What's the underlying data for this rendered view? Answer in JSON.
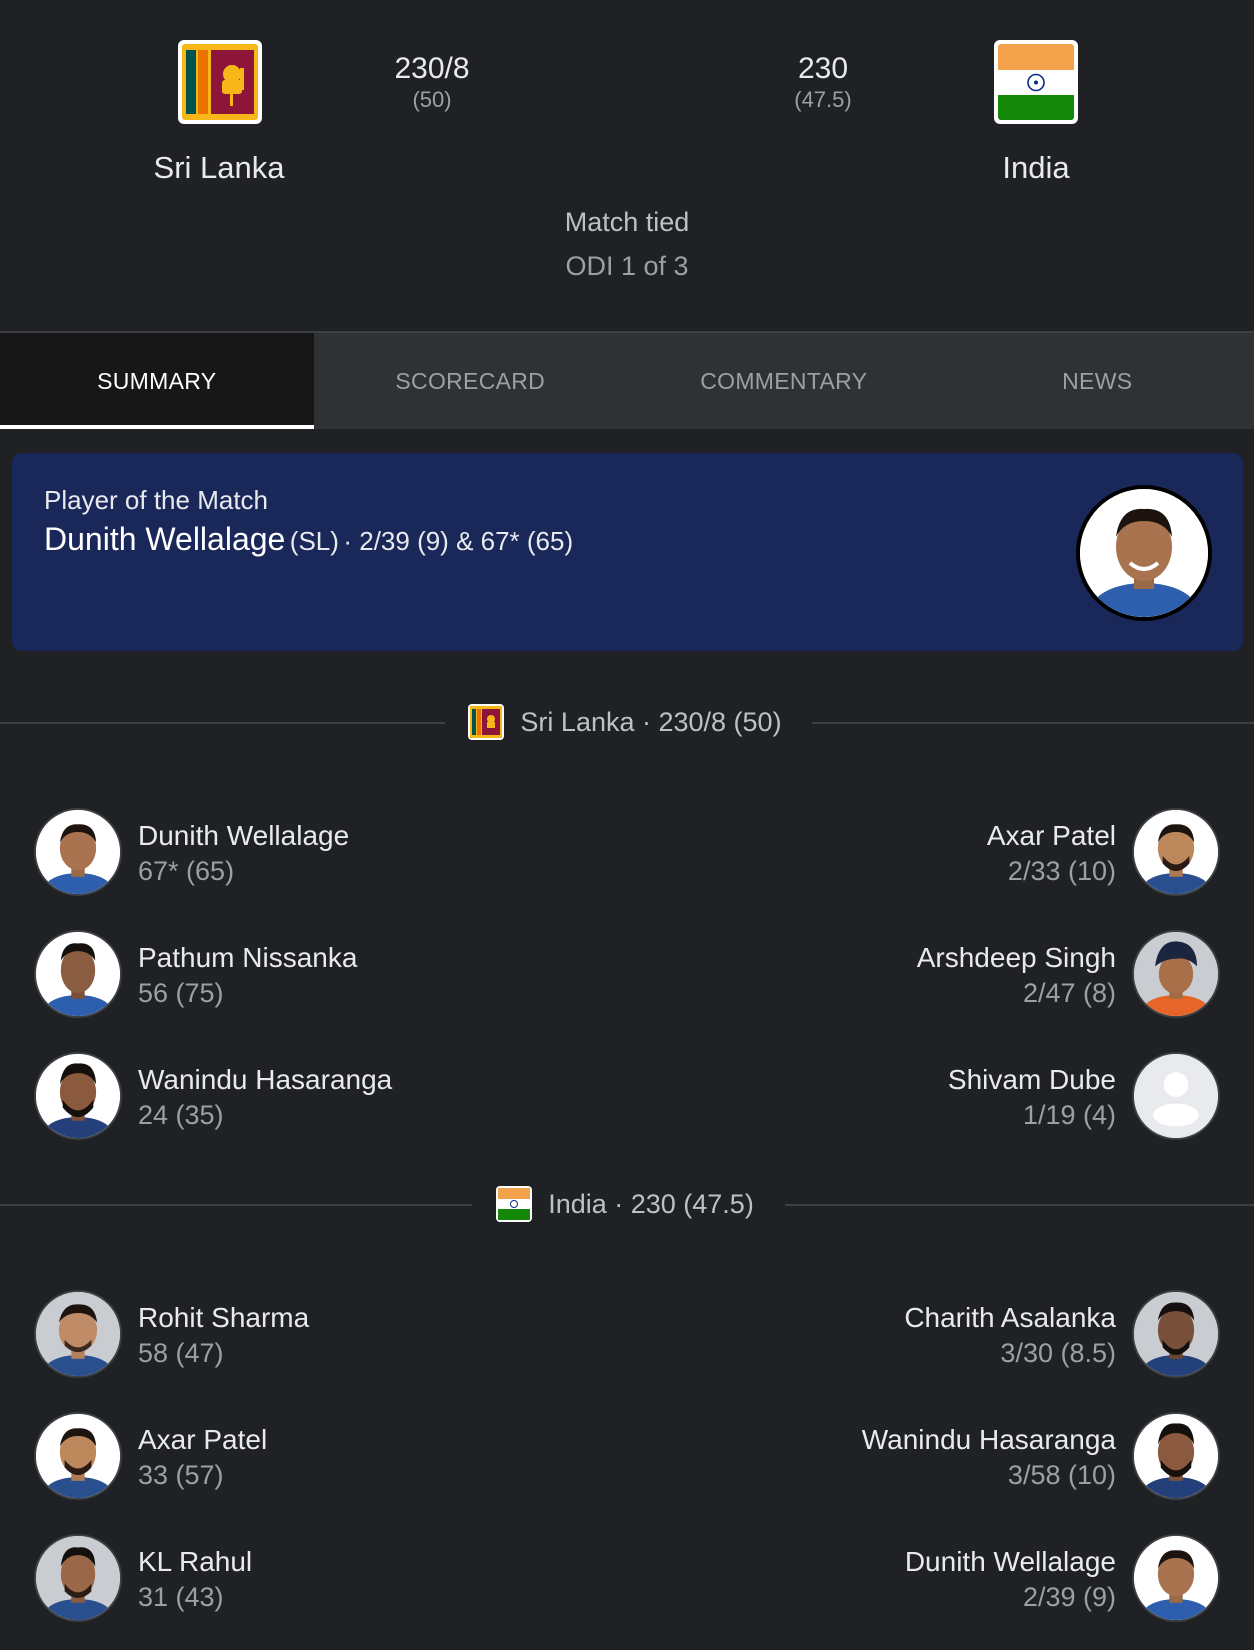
{
  "match": {
    "home": {
      "name": "Sri Lanka",
      "runs": "230/8",
      "overs": "(50)",
      "flag": "sri-lanka-flag"
    },
    "away": {
      "name": "India",
      "runs": "230",
      "overs": "(47.5)",
      "flag": "india-flag"
    },
    "result": "Match tied",
    "series": "ODI 1 of 3"
  },
  "tabs": [
    {
      "label": "SUMMARY",
      "active": true
    },
    {
      "label": "SCORECARD",
      "active": false
    },
    {
      "label": "COMMENTARY",
      "active": false
    },
    {
      "label": "NEWS",
      "active": false
    }
  ],
  "player_of_match": {
    "label": "Player of the Match",
    "name": "Dunith Wellalage",
    "team": "(SL)",
    "stats": "· 2/39 (9) & 67* (65)"
  },
  "innings": [
    {
      "heading": "Sri Lanka · 230/8 (50)",
      "flag": "sri-lanka-flag",
      "batters": [
        {
          "name": "Dunith Wellalage",
          "stat": "67* (65)"
        },
        {
          "name": "Pathum Nissanka",
          "stat": "56 (75)"
        },
        {
          "name": "Wanindu Hasaranga",
          "stat": "24 (35)"
        }
      ],
      "bowlers": [
        {
          "name": "Axar Patel",
          "stat": "2/33 (10)"
        },
        {
          "name": "Arshdeep Singh",
          "stat": "2/47 (8)"
        },
        {
          "name": "Shivam Dube",
          "stat": "1/19 (4)"
        }
      ]
    },
    {
      "heading": "India · 230 (47.5)",
      "flag": "india-flag",
      "batters": [
        {
          "name": "Rohit Sharma",
          "stat": "58 (47)"
        },
        {
          "name": "Axar Patel",
          "stat": "33 (57)"
        },
        {
          "name": "KL Rahul",
          "stat": "31 (43)"
        }
      ],
      "bowlers": [
        {
          "name": "Charith Asalanka",
          "stat": "3/30 (8.5)"
        },
        {
          "name": "Wanindu Hasaranga",
          "stat": "3/58 (10)"
        },
        {
          "name": "Dunith Wellalage",
          "stat": "2/39 (9)"
        }
      ]
    }
  ],
  "colors": {
    "background": "#202124",
    "tab_bar": "#303134",
    "tab_active": "#171717",
    "potm_card": "#1a2759"
  }
}
